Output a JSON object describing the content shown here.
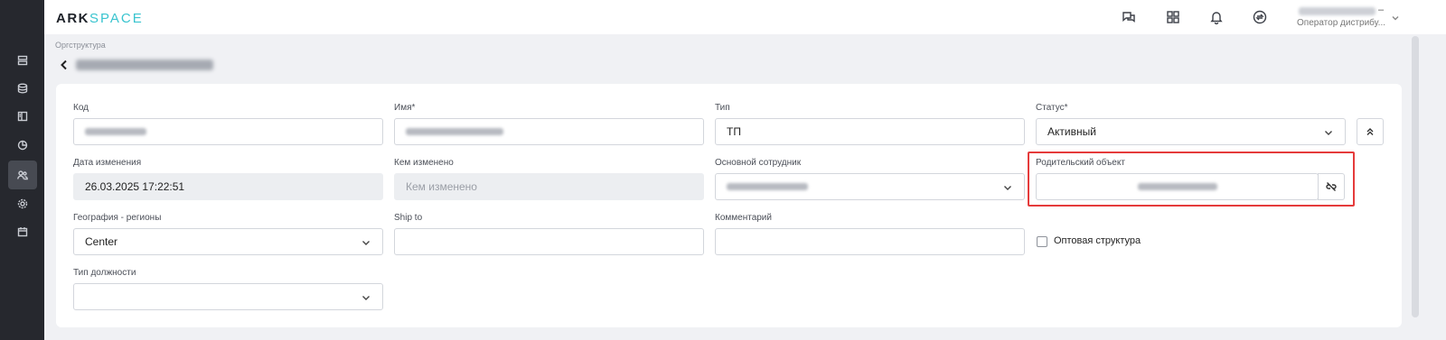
{
  "app": {
    "logo_main": "ARK",
    "logo_accent": "SPACE",
    "user_dash": "–",
    "user_role": "Оператор дистрибу..."
  },
  "sidebar_icons": [
    "list-icon",
    "database-icon",
    "book-icon",
    "pie-chart-icon",
    "users-icon",
    "settings-icon",
    "calendar-icon"
  ],
  "topbar_icons": [
    "chat-icon",
    "apps-grid-icon",
    "bell-icon",
    "sync-icon"
  ],
  "breadcrumb": "Оргструктура",
  "form": {
    "kod_label": "Код",
    "imya_label": "Имя*",
    "tip_label": "Тип",
    "tip_value": "ТП",
    "status_label": "Статус*",
    "status_value": "Активный",
    "data_label": "Дата изменения",
    "data_value": "26.03.2025 17:22:51",
    "kem_label": "Кем изменено",
    "kem_placeholder": "Кем изменено",
    "sotrudnik_label": "Основной сотрудник",
    "roditel_label": "Родительский объект",
    "geo_label": "География - регионы",
    "geo_value": "Center",
    "shipto_label": "Ship to",
    "comment_label": "Комментарий",
    "optovaya_label": "Оптовая структура",
    "dolzhnost_label": "Тип должности"
  },
  "colors": {
    "sidebar_bg": "#26282e",
    "accent": "#39c4cf",
    "highlight": "#e53b3b"
  }
}
